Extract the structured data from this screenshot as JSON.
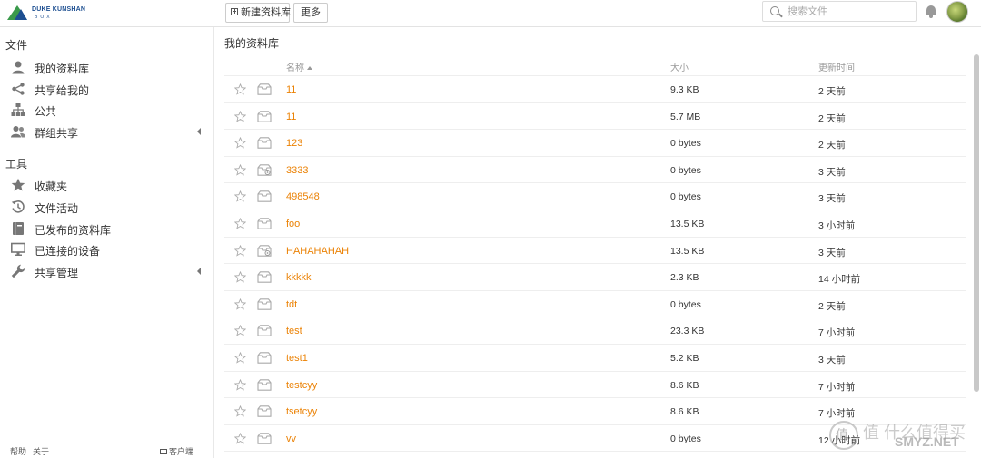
{
  "header": {
    "logo_line1": "DUKE KUNSHAN",
    "logo_line2": "BOX",
    "new_library_label": "新建资料库",
    "more_label": "更多",
    "search_placeholder": "搜索文件"
  },
  "sidebar": {
    "files_heading": "文件",
    "files_items": [
      {
        "label": "我的资料库",
        "icon": "user-icon"
      },
      {
        "label": "共享给我的",
        "icon": "share-icon"
      },
      {
        "label": "公共",
        "icon": "org-tree-icon"
      },
      {
        "label": "群组共享",
        "icon": "group-icon"
      }
    ],
    "tools_heading": "工具",
    "tools_items": [
      {
        "label": "收藏夹",
        "icon": "star-icon"
      },
      {
        "label": "文件活动",
        "icon": "history-icon"
      },
      {
        "label": "已发布的资料库",
        "icon": "book-icon"
      },
      {
        "label": "已连接的设备",
        "icon": "monitor-icon"
      },
      {
        "label": "共享管理",
        "icon": "wrench-icon"
      }
    ],
    "footer": {
      "help": "帮助",
      "about": "关于",
      "client": "客户端"
    }
  },
  "main": {
    "title": "我的资料库",
    "columns": {
      "name": "名称",
      "size": "大小",
      "time": "更新时间"
    },
    "rows": [
      {
        "name": "11",
        "size": "9.3 KB",
        "time": "2 天前",
        "shared": false
      },
      {
        "name": "11",
        "size": "5.7 MB",
        "time": "2 天前",
        "shared": false
      },
      {
        "name": "123",
        "size": "0 bytes",
        "time": "2 天前",
        "shared": false
      },
      {
        "name": "3333",
        "size": "0 bytes",
        "time": "3 天前",
        "shared": true
      },
      {
        "name": "498548",
        "size": "0 bytes",
        "time": "3 天前",
        "shared": false
      },
      {
        "name": "foo",
        "size": "13.5 KB",
        "time": "3 小时前",
        "shared": false
      },
      {
        "name": "HAHAHAHAH",
        "size": "13.5 KB",
        "time": "3 天前",
        "shared": true
      },
      {
        "name": "kkkkk",
        "size": "2.3 KB",
        "time": "14 小时前",
        "shared": false
      },
      {
        "name": "tdt",
        "size": "0 bytes",
        "time": "2 天前",
        "shared": false
      },
      {
        "name": "test",
        "size": "23.3 KB",
        "time": "7 小时前",
        "shared": false
      },
      {
        "name": "test1",
        "size": "5.2 KB",
        "time": "3 天前",
        "shared": false
      },
      {
        "name": "testcyy",
        "size": "8.6 KB",
        "time": "7 小时前",
        "shared": false
      },
      {
        "name": "tsetcyy",
        "size": "8.6 KB",
        "time": "7 小时前",
        "shared": false
      },
      {
        "name": "vv",
        "size": "0 bytes",
        "time": "12 小时前",
        "shared": false
      }
    ]
  },
  "watermark": {
    "line1": "值 什么值得买",
    "line2": "SMYZ.NET"
  },
  "colors": {
    "link": "#eb8205",
    "text": "#333333",
    "muted": "#999999",
    "border": "#eeeeee"
  }
}
